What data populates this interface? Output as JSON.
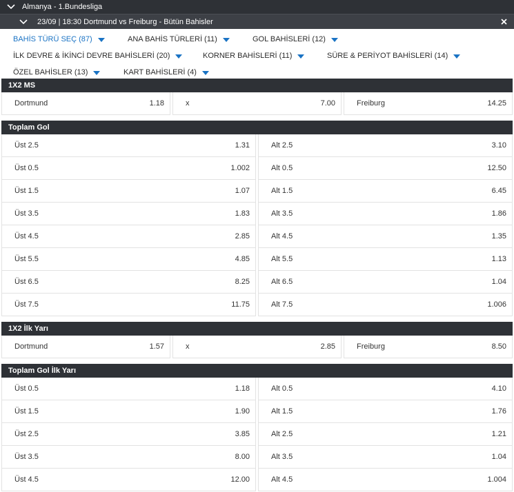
{
  "header": {
    "league": "Almanya - 1.Bundesliga",
    "match": "23/09 | 18:30 Dortmund vs Freiburg - Bütün Bahisler"
  },
  "filters": [
    {
      "label": "BAHİS TÜRÜ SEÇ (87)",
      "active": true
    },
    {
      "label": "ANA BAHİS TÜRLERİ (11)",
      "active": false
    },
    {
      "label": "GOL BAHİSLERİ (12)",
      "active": false
    },
    {
      "label": "İLK DEVRE & İKİNCİ DEVRE BAHİSLERİ (20)",
      "active": false
    },
    {
      "label": "KORNER BAHİSLERİ (11)",
      "active": false
    },
    {
      "label": "SÜRE & PERİYOT BAHİSLERİ (14)",
      "active": false
    },
    {
      "label": "ÖZEL BAHİSLER (13)",
      "active": false
    },
    {
      "label": "KART BAHİSLERİ (4)",
      "active": false
    }
  ],
  "markets": {
    "ms": {
      "title": "1X2 MS",
      "outcomes": [
        {
          "label": "Dortmund",
          "odd": "1.18"
        },
        {
          "label": "x",
          "odd": "7.00"
        },
        {
          "label": "Freiburg",
          "odd": "14.25"
        }
      ]
    },
    "total_goals": {
      "title": "Toplam Gol",
      "rows": [
        {
          "over_label": "Üst 2.5",
          "over_odd": "1.31",
          "under_label": "Alt 2.5",
          "under_odd": "3.10"
        },
        {
          "over_label": "Üst 0.5",
          "over_odd": "1.002",
          "under_label": "Alt 0.5",
          "under_odd": "12.50"
        },
        {
          "over_label": "Üst 1.5",
          "over_odd": "1.07",
          "under_label": "Alt 1.5",
          "under_odd": "6.45"
        },
        {
          "over_label": "Üst 3.5",
          "over_odd": "1.83",
          "under_label": "Alt 3.5",
          "under_odd": "1.86"
        },
        {
          "over_label": "Üst 4.5",
          "over_odd": "2.85",
          "under_label": "Alt 4.5",
          "under_odd": "1.35"
        },
        {
          "over_label": "Üst 5.5",
          "over_odd": "4.85",
          "under_label": "Alt 5.5",
          "under_odd": "1.13"
        },
        {
          "over_label": "Üst 6.5",
          "over_odd": "8.25",
          "under_label": "Alt 6.5",
          "under_odd": "1.04"
        },
        {
          "over_label": "Üst 7.5",
          "over_odd": "11.75",
          "under_label": "Alt 7.5",
          "under_odd": "1.006"
        }
      ]
    },
    "ht": {
      "title": "1X2 İlk Yarı",
      "outcomes": [
        {
          "label": "Dortmund",
          "odd": "1.57"
        },
        {
          "label": "x",
          "odd": "2.85"
        },
        {
          "label": "Freiburg",
          "odd": "8.50"
        }
      ]
    },
    "total_goals_ht": {
      "title": "Toplam Gol İlk Yarı",
      "rows": [
        {
          "over_label": "Üst 0.5",
          "over_odd": "1.18",
          "under_label": "Alt 0.5",
          "under_odd": "4.10"
        },
        {
          "over_label": "Üst 1.5",
          "over_odd": "1.90",
          "under_label": "Alt 1.5",
          "under_odd": "1.76"
        },
        {
          "over_label": "Üst 2.5",
          "over_odd": "3.85",
          "under_label": "Alt 2.5",
          "under_odd": "1.21"
        },
        {
          "over_label": "Üst 3.5",
          "over_odd": "8.00",
          "under_label": "Alt 3.5",
          "under_odd": "1.04"
        },
        {
          "over_label": "Üst 4.5",
          "over_odd": "12.00",
          "under_label": "Alt 4.5",
          "under_odd": "1.004"
        }
      ]
    }
  },
  "colors": {
    "header_bg": "#2e3136",
    "accent": "#1a73c4"
  },
  "icons": {
    "collapse": "chevron-down-icon",
    "close": "close-icon",
    "dropdown": "caret-down-icon"
  }
}
